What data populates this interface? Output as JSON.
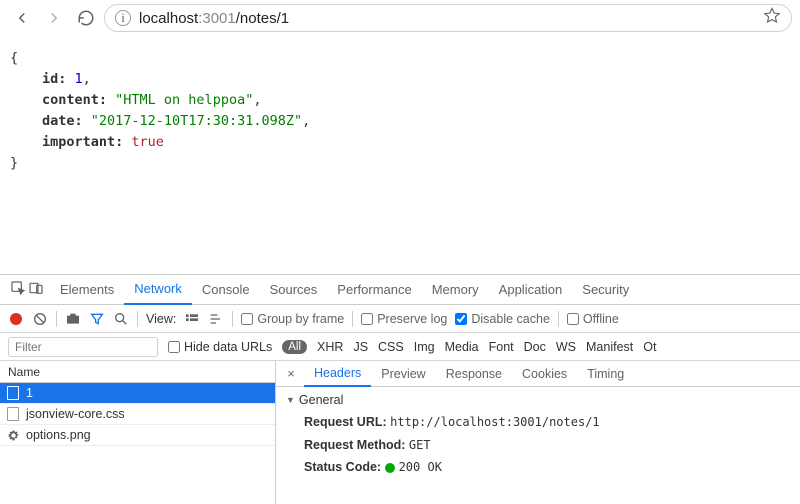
{
  "browser": {
    "url_host": "localhost",
    "url_port": ":3001",
    "url_path": "/notes/1"
  },
  "json_view": {
    "open": "{",
    "close": "}",
    "rows": [
      {
        "key": "id",
        "value": "1",
        "kind": "num",
        "comma": ","
      },
      {
        "key": "content",
        "value": "\"HTML on helppoa\"",
        "kind": "str",
        "comma": ","
      },
      {
        "key": "date",
        "value": "\"2017-12-10T17:30:31.098Z\"",
        "kind": "str",
        "comma": ","
      },
      {
        "key": "important",
        "value": "true",
        "kind": "bool",
        "comma": ""
      }
    ]
  },
  "devtools": {
    "tabs": [
      "Elements",
      "Network",
      "Console",
      "Sources",
      "Performance",
      "Memory",
      "Application",
      "Security"
    ],
    "active_tab": "Network",
    "view_label": "View:",
    "group_by_frame": "Group by frame",
    "preserve_log": "Preserve log",
    "disable_cache": "Disable cache",
    "offline": "Offline",
    "filter_placeholder": "Filter",
    "hide_data_urls": "Hide data URLs",
    "filter_all": "All",
    "filter_types": [
      "XHR",
      "JS",
      "CSS",
      "Img",
      "Media",
      "Font",
      "Doc",
      "WS",
      "Manifest",
      "Ot"
    ],
    "name_header": "Name",
    "requests": [
      {
        "name": "1",
        "icon": "doc",
        "selected": true
      },
      {
        "name": "jsonview-core.css",
        "icon": "doc",
        "selected": false
      },
      {
        "name": "options.png",
        "icon": "gear",
        "selected": false
      }
    ],
    "detail_tabs": [
      "Headers",
      "Preview",
      "Response",
      "Cookies",
      "Timing"
    ],
    "detail_active": "Headers",
    "general_label": "General",
    "request_url_label": "Request URL:",
    "request_url_value": "http://localhost:3001/notes/1",
    "request_method_label": "Request Method:",
    "request_method_value": "GET",
    "status_code_label": "Status Code:",
    "status_code_value": "200 OK"
  }
}
